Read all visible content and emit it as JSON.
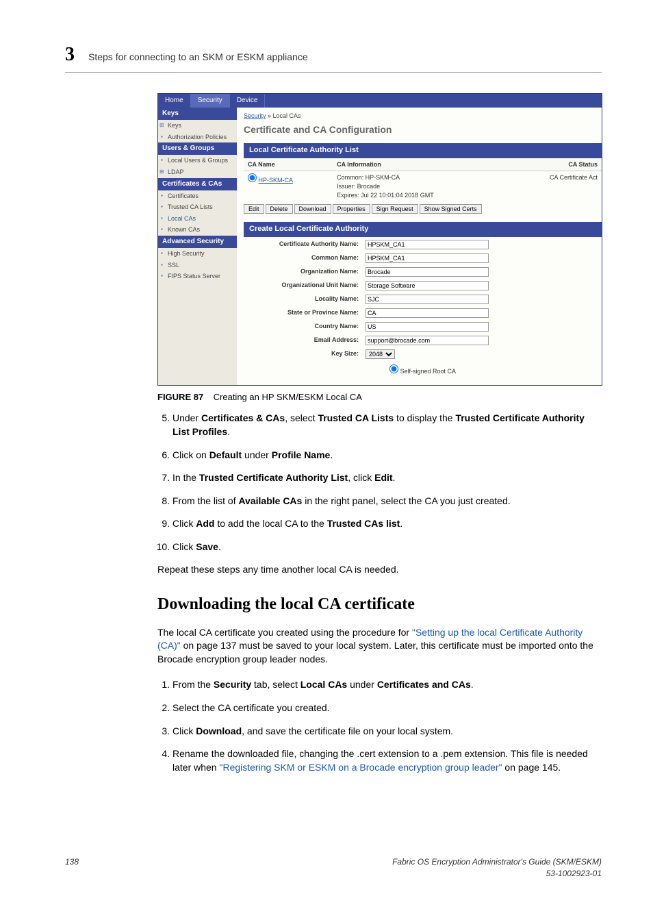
{
  "header": {
    "chapter": "3",
    "title": "Steps for connecting to an SKM or ESKM appliance"
  },
  "app": {
    "tabs": [
      "Home",
      "Security",
      "Device"
    ],
    "side": {
      "keys_head": "Keys",
      "keys_items": [
        "Keys",
        "Authorization Policies"
      ],
      "users_head": "Users & Groups",
      "users_items": [
        "Local Users & Groups",
        "LDAP"
      ],
      "certs_head": "Certificates & CAs",
      "certs_items": [
        "Certificates",
        "Trusted CA Lists",
        "Local CAs",
        "Known CAs"
      ],
      "adv_head": "Advanced Security",
      "adv_items": [
        "High Security",
        "SSL",
        "FIPS Status Server"
      ]
    },
    "crumb_link": "Security",
    "crumb_tail": " » Local CAs",
    "main_title": "Certificate and CA Configuration",
    "panel1": "Local Certificate Authority List",
    "th_name": "CA Name",
    "th_info": "CA Information",
    "th_status": "CA Status",
    "row_name": "HP-SKM-CA",
    "row_info1": "Common: HP-SKM-CA",
    "row_info2": "Issuer: Brocade",
    "row_info3": "Expires: Jul 22 10:01:04 2018 GMT",
    "row_status": "CA Certificate Act",
    "buttons": [
      "Edit",
      "Delete",
      "Download",
      "Properties",
      "Sign Request",
      "Show Signed Certs"
    ],
    "panel2": "Create Local Certificate Authority",
    "form": {
      "l_can": "Certificate Authority Name:",
      "v_can": "HPSKM_CA1",
      "l_cn": "Common Name:",
      "v_cn": "HPSKM_CA1",
      "l_on": "Organization Name:",
      "v_on": "Brocade",
      "l_oun": "Organizational Unit Name:",
      "v_oun": "Storage Software",
      "l_loc": "Locality Name:",
      "v_loc": "SJC",
      "l_st": "State or Province Name:",
      "v_st": "CA",
      "l_co": "Country Name:",
      "v_co": "US",
      "l_em": "Email Address:",
      "v_em": "support@brocade.com",
      "l_ks": "Key Size:",
      "v_ks": "2048",
      "radio": "Self-signed Root CA"
    }
  },
  "fig_label": "FIGURE 87",
  "fig_caption": "Creating an HP SKM/ESKM Local CA",
  "steps1": [
    {
      "n": "5",
      "html": "Under <b>Certificates & CAs</b>, select <b>Trusted CA Lists</b> to display the <b>Trusted Certificate Authority List Profiles</b>."
    },
    {
      "n": "6",
      "html": "Click on <b>Default</b> under <b>Profile Name</b>."
    },
    {
      "n": "7",
      "html": "In the <b>Trusted Certificate Authority List</b>, click <b>Edit</b>."
    },
    {
      "n": "8",
      "html": "From the list of <b>Available CAs</b> in the right panel, select the CA you just created."
    },
    {
      "n": "9",
      "html": "Click <b>Add</b> to add the local CA to the <b>Trusted CAs list</b>."
    },
    {
      "n": "10",
      "html": "Click <b>Save</b>."
    }
  ],
  "repeat": "Repeat these steps any time another local CA is needed.",
  "h2": "Downloading the local CA certificate",
  "p2a": "The local CA certificate you created using the procedure for ",
  "p2link": "\"Setting up the local Certificate Authority (CA)\"",
  "p2b": " on page 137 must be saved to your local system. Later, this certificate must be imported onto the Brocade encryption group leader nodes.",
  "steps2": [
    {
      "n": "1",
      "html": "From the <b>Security</b> tab, select <b>Local CAs</b> under <b>Certificates and CAs</b>."
    },
    {
      "n": "2",
      "html": "Select the CA certificate you created."
    },
    {
      "n": "3",
      "html": "Click <b>Download</b>, and save the certificate file on your local system."
    },
    {
      "n": "4",
      "html": "Rename the downloaded file, changing the .cert extension to a .pem extension. This file is needed later when <span class=\"link\">\"Registering SKM or ESKM on a Brocade encryption group leader\"</span> on page 145."
    }
  ],
  "footer": {
    "page": "138",
    "doc1": "Fabric OS Encryption Administrator's Guide (SKM/ESKM)",
    "doc2": "53-1002923-01"
  }
}
